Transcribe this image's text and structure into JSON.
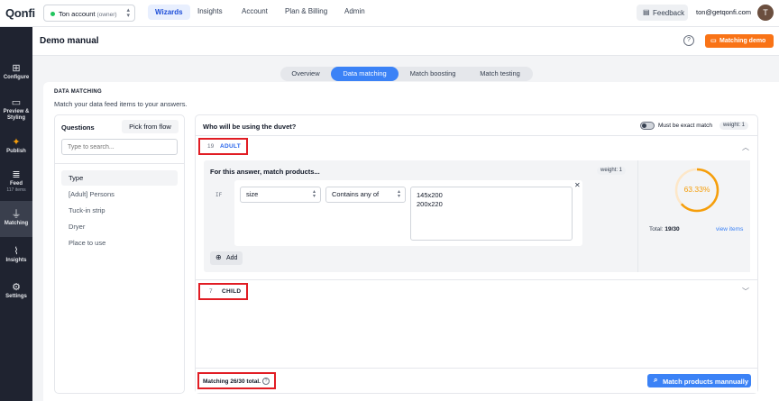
{
  "app": {
    "logo": "Qonfi"
  },
  "account": {
    "name": "Ton account",
    "role": "(owner)"
  },
  "topnav": [
    {
      "label": "Wizards",
      "active": true
    },
    {
      "label": "Insights"
    },
    {
      "label": "Account"
    },
    {
      "label": "Plan & Billing"
    },
    {
      "label": "Admin"
    }
  ],
  "header_right": {
    "feedback_label": "Feedback",
    "email": "ton@getqonfi.com",
    "avatar_initial": "T"
  },
  "sidebar": {
    "items": [
      {
        "label": "Configure",
        "icon": "configure-icon",
        "glyph": "⊞"
      },
      {
        "label": "Preview & Styling",
        "icon": "monitor-icon",
        "glyph": "▭"
      },
      {
        "label": "Publish",
        "icon": "party-icon",
        "glyph": "✦"
      },
      {
        "label": "Feed",
        "sub": "117 items",
        "icon": "database-icon",
        "glyph": "≣"
      },
      {
        "label": "Matching",
        "icon": "filter-icon",
        "glyph": "⏚",
        "active": true
      },
      {
        "label": "Insights",
        "icon": "chart-icon",
        "glyph": "⌇"
      },
      {
        "label": "Settings",
        "icon": "gear-icon",
        "glyph": "⚙"
      }
    ]
  },
  "page": {
    "title": "Demo manual",
    "help": "?",
    "match_demo_label": "Matching demo"
  },
  "tabs": [
    {
      "label": "Overview"
    },
    {
      "label": "Data matching",
      "active": true
    },
    {
      "label": "Match boosting"
    },
    {
      "label": "Match testing"
    }
  ],
  "section": {
    "label": "DATA MATCHING",
    "description": "Match your data feed items to your answers."
  },
  "questions": {
    "title": "Questions",
    "pick_flow": "Pick from flow",
    "search_placeholder": "Type to search...",
    "items": [
      {
        "label": "Type",
        "active": true
      },
      {
        "label": "[Adult] Persons"
      },
      {
        "label": "Tuck-in strip"
      },
      {
        "label": "Dryer"
      },
      {
        "label": "Place to use"
      }
    ]
  },
  "question": {
    "title": "Who will be using the duvet?",
    "exact_label": "Must be exact match",
    "weight": "weight: 1"
  },
  "answers": [
    {
      "count": "19",
      "label": "ADULT",
      "color": "#2563eb"
    },
    {
      "count": "7",
      "label": "CHILD",
      "color": "#111827"
    }
  ],
  "rule": {
    "title": "For this answer, match products...",
    "weight": "weight: 1",
    "if_label": "IF",
    "attribute": "size",
    "operator": "Contains any of",
    "values": [
      "145x200",
      "200x220"
    ],
    "add_label": "Add"
  },
  "stats": {
    "percent": "63.33%",
    "fraction": 0.6333,
    "total_label": "Total:",
    "total_value": "19/30",
    "view_items": "view items",
    "ring_color": "#f59e0b"
  },
  "footer": {
    "matching_total": "Matching 26/30 total.",
    "match_manually": "Match products mannually"
  }
}
